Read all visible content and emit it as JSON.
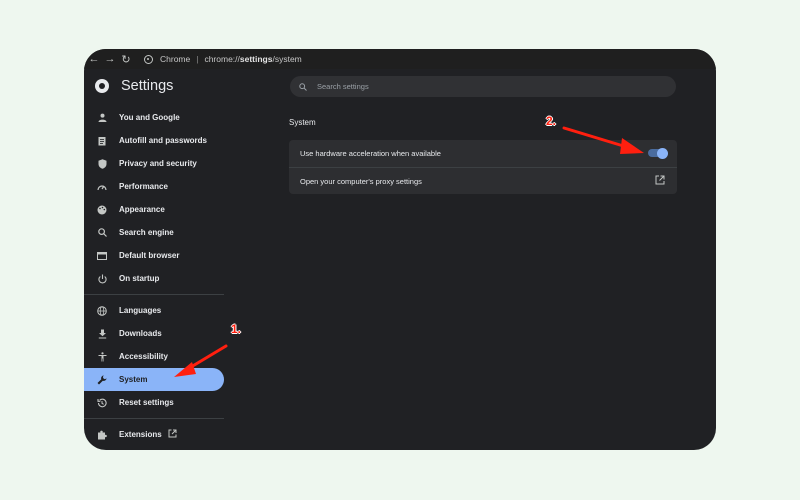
{
  "browser": {
    "site_name": "Chrome",
    "url_prefix": "chrome://",
    "url_bold": "settings",
    "url_suffix": "/system"
  },
  "header": {
    "title": "Settings",
    "search_placeholder": "Search settings"
  },
  "sidebar": {
    "items": [
      {
        "label": "You and Google",
        "icon": "person-icon"
      },
      {
        "label": "Autofill and passwords",
        "icon": "clipboard-icon"
      },
      {
        "label": "Privacy and security",
        "icon": "shield-icon"
      },
      {
        "label": "Performance",
        "icon": "speedometer-icon"
      },
      {
        "label": "Appearance",
        "icon": "palette-icon"
      },
      {
        "label": "Search engine",
        "icon": "search-icon"
      },
      {
        "label": "Default browser",
        "icon": "browser-icon"
      },
      {
        "label": "On startup",
        "icon": "power-icon"
      },
      {
        "label": "Languages",
        "icon": "globe-icon"
      },
      {
        "label": "Downloads",
        "icon": "download-icon"
      },
      {
        "label": "Accessibility",
        "icon": "accessibility-icon"
      },
      {
        "label": "System",
        "icon": "wrench-icon",
        "active": true
      },
      {
        "label": "Reset settings",
        "icon": "history-icon"
      },
      {
        "label": "Extensions",
        "icon": "puzzle-icon"
      }
    ]
  },
  "main": {
    "section_title": "System",
    "rows": [
      {
        "label": "Use hardware acceleration when available",
        "control": "toggle",
        "toggle_on": true
      },
      {
        "label": "Open your computer's proxy settings",
        "control": "open-external-icon"
      }
    ]
  },
  "annotations": {
    "step1": "1.",
    "step2": "2.",
    "arrow_color": "#ff1f0f"
  },
  "colors": {
    "accent": "#8ab4f8",
    "background": "#202124",
    "page_bg": "#eef7ef"
  }
}
